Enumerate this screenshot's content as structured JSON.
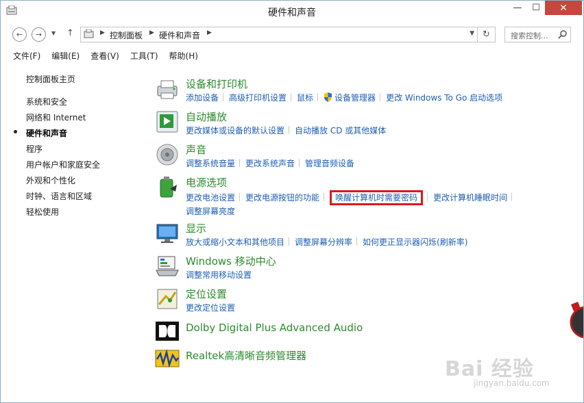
{
  "window": {
    "title": "硬件和声音",
    "minimize_glyph": "—",
    "maximize_glyph": "☐",
    "close_glyph": "✕"
  },
  "nav": {
    "back_glyph": "←",
    "forward_glyph": "→",
    "dropdown_glyph": "▼",
    "up_glyph": "↑",
    "refresh_glyph": "↻",
    "breadcrumbs": [
      "控制面板",
      "硬件和声音"
    ],
    "search_placeholder": "搜索控制..."
  },
  "menu": [
    "文件(F)",
    "编辑(E)",
    "查看(V)",
    "工具(T)",
    "帮助(H)"
  ],
  "sidebar": {
    "items": [
      {
        "label": "控制面板主页"
      },
      {
        "label": "系统和安全"
      },
      {
        "label": "网络和 Internet"
      },
      {
        "label": "硬件和声音",
        "current": true
      },
      {
        "label": "程序"
      },
      {
        "label": "用户帐户和家庭安全"
      },
      {
        "label": "外观和个性化"
      },
      {
        "label": "时钟、语言和区域"
      },
      {
        "label": "轻松使用"
      }
    ]
  },
  "categories": [
    {
      "title": "设备和打印机",
      "icon": "printer-icon",
      "links": [
        "添加设备",
        "高级打印机设置",
        "鼠标",
        "设备管理器",
        "更改 Windows To Go 启动选项"
      ]
    },
    {
      "title": "自动播放",
      "icon": "autoplay-icon",
      "links": [
        "更改媒体或设备的默认设置",
        "自动播放 CD 或其他媒体"
      ]
    },
    {
      "title": "声音",
      "icon": "speaker-icon",
      "links": [
        "调整系统音量",
        "更改系统声音",
        "管理音频设备"
      ]
    },
    {
      "title": "电源选项",
      "icon": "battery-icon",
      "links": [
        "更改电池设置",
        "更改电源按钮的功能",
        "唤醒计算机时需要密码",
        "更改计算机睡眠时间",
        "调整屏幕亮度"
      ]
    },
    {
      "title": "显示",
      "icon": "display-icon",
      "links": [
        "放大或缩小文本和其他项目",
        "调整屏幕分辨率",
        "如何更正显示器闪烁(刷新率)"
      ]
    },
    {
      "title": "Windows 移动中心",
      "icon": "mobility-center-icon",
      "links": [
        "调整常用移动设置"
      ]
    },
    {
      "title": "定位设置",
      "icon": "location-icon",
      "links": [
        "更改定位设置"
      ]
    },
    {
      "title": "Dolby Digital Plus Advanced Audio",
      "icon": "dolby-icon",
      "links": []
    },
    {
      "title": "Realtek高清晰音频管理器",
      "icon": "realtek-icon",
      "links": []
    }
  ],
  "highlight_color": "#e0161b",
  "link_color": "#1e5eb4",
  "title_color": "#2d8a2d",
  "watermark": {
    "text": "Bai 经验",
    "url": "jingyan.baidu.com"
  }
}
